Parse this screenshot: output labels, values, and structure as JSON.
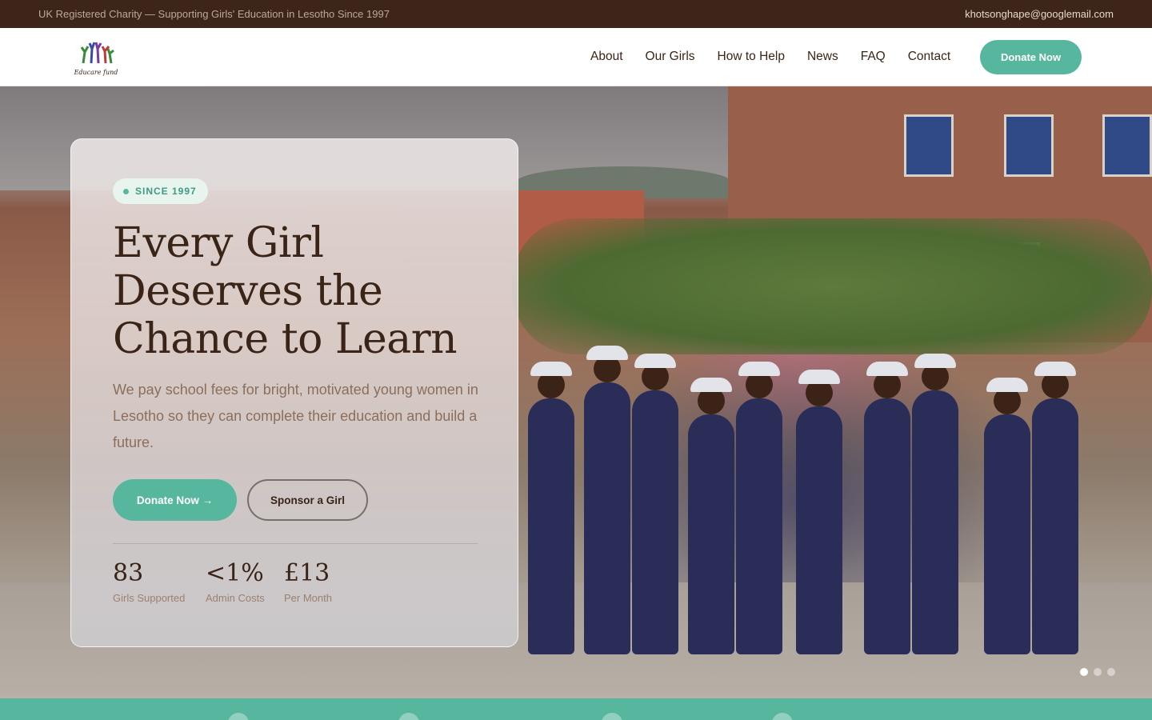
{
  "topbar": {
    "tagline": "UK Registered Charity — Supporting Girls' Education in Lesotho Since 1997",
    "email": "khotsonghape@googlemail.com"
  },
  "header": {
    "logo_text": "Educare fund",
    "logo_icon": "raised-hands-logo",
    "nav": [
      {
        "label": "About"
      },
      {
        "label": "Our Girls"
      },
      {
        "label": "How to Help"
      },
      {
        "label": "News"
      },
      {
        "label": "FAQ"
      },
      {
        "label": "Contact"
      }
    ],
    "donate_label": "Donate Now"
  },
  "hero": {
    "badge": "SINCE 1997",
    "title": "Every Girl Deserves the Chance to Learn",
    "subtitle": "We pay school fees for bright, motivated young women in Lesotho so they can complete their education and build a future.",
    "primary_cta": "Donate Now →",
    "secondary_cta": "Sponsor a Girl",
    "stats": [
      {
        "value": "83",
        "label": "Girls Supported"
      },
      {
        "value": "<1%",
        "label": "Admin Costs"
      },
      {
        "value": "£13",
        "label": "Per Month"
      }
    ],
    "carousel": {
      "slides": 3,
      "active": 1
    }
  },
  "colors": {
    "brand_green": "#56b79e",
    "dark_brown": "#3d2519",
    "heading_brown": "#3a2417",
    "muted_brown": "#8b6f5c"
  }
}
